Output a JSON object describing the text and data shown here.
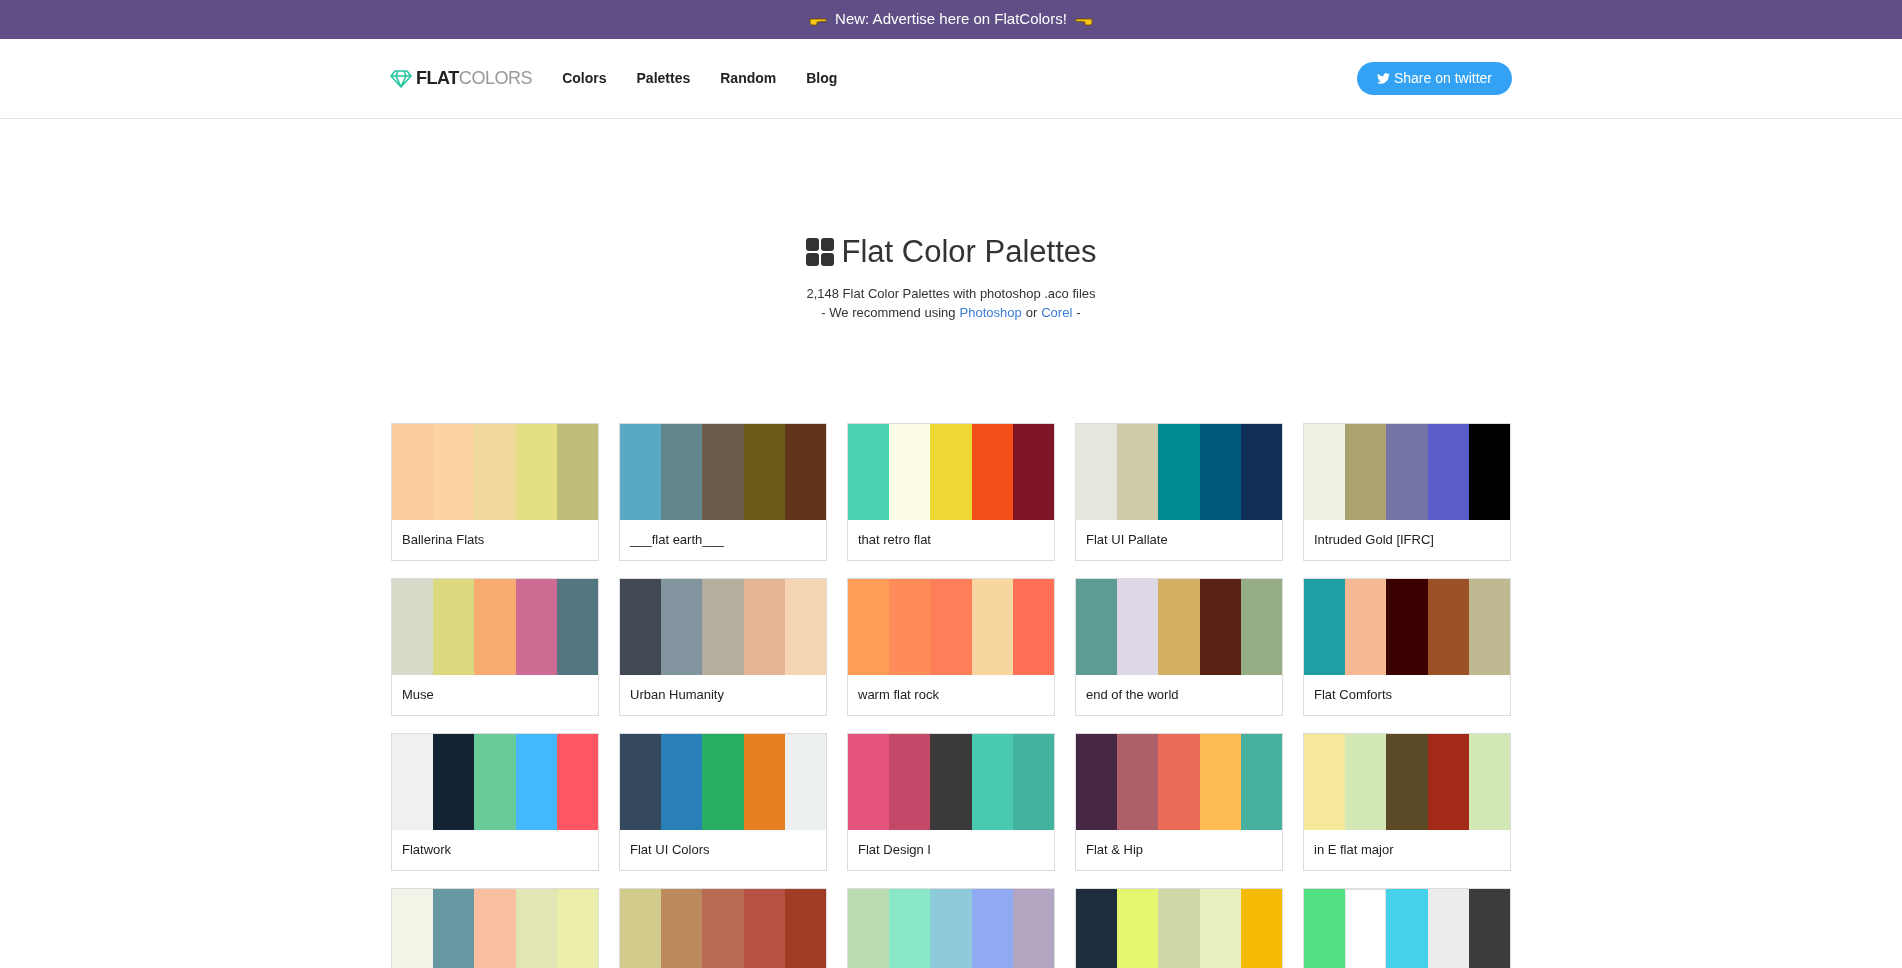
{
  "banner": {
    "text": "New: Advertise here on FlatColors!"
  },
  "nav": {
    "logo": {
      "bold": "FLAT",
      "light": "COLORS"
    },
    "links": [
      "Colors",
      "Palettes",
      "Random",
      "Blog"
    ],
    "share_button": "Share on twitter"
  },
  "hero": {
    "title": "Flat Color Palettes",
    "subtitle": "2,148 Flat Color Palettes with photoshop .aco files",
    "recommend": {
      "before": "- We recommend using",
      "link1": "Photoshop",
      "middle": "or",
      "link2": "Corel",
      "after": "-"
    }
  },
  "palettes": [
    {
      "name": "Ballerina Flats",
      "swatches": [
        {
          "color": "#fbcb9c"
        },
        {
          "color": "#fcd3a1"
        },
        {
          "color": "#f1d89d"
        },
        {
          "color": "#e4df83"
        },
        {
          "color": "#bfbc7a"
        }
      ]
    },
    {
      "name": "___flat earth___",
      "swatches": [
        {
          "color": "#5aa9c4"
        },
        {
          "color": "#61868d"
        },
        {
          "color": "#6c5c4b"
        },
        {
          "color": "#695a16"
        },
        {
          "color": "#613519"
        }
      ]
    },
    {
      "name": "that retro flat",
      "swatches": [
        {
          "color": "#4bd4b3"
        },
        {
          "color": "#fdfce7"
        },
        {
          "color": "#edd834"
        },
        {
          "color": "#f24e1a"
        },
        {
          "color": "#7e1426"
        }
      ]
    },
    {
      "name": "Flat UI Pallate",
      "swatches": [
        {
          "color": "#e5e6de"
        },
        {
          "color": "#cfcaa7"
        },
        {
          "color": "#028a92"
        },
        {
          "color": "#015a7b"
        },
        {
          "color": "#0f2f57"
        }
      ]
    },
    {
      "name": "Intruded Gold [IFRC]",
      "swatches": [
        {
          "color": "#eef2e4"
        },
        {
          "color": "#aaa36f"
        },
        {
          "color": "#7475a6"
        },
        {
          "color": "#5a5cc9"
        },
        {
          "color": "#000000"
        }
      ]
    },
    {
      "name": "Muse",
      "swatches": [
        {
          "color": "#d6dbc9"
        },
        {
          "color": "#dcd880"
        },
        {
          "color": "#f8ab71"
        },
        {
          "color": "#cd6b93"
        },
        {
          "color": "#537780"
        }
      ]
    },
    {
      "name": "Urban Humanity",
      "swatches": [
        {
          "color": "#424954"
        },
        {
          "color": "#82959f"
        },
        {
          "color": "#b5ae9f"
        },
        {
          "color": "#e3b594"
        },
        {
          "color": "#f6d5b3"
        }
      ]
    },
    {
      "name": "warm flat rock",
      "swatches": [
        {
          "color": "#ff9e57"
        },
        {
          "color": "#ff8c59"
        },
        {
          "color": "#ff7f59"
        },
        {
          "color": "#f7d69f"
        },
        {
          "color": "#ff7056"
        }
      ]
    },
    {
      "name": "end of the world",
      "swatches": [
        {
          "color": "#5c9c92"
        },
        {
          "color": "#ded8e6"
        },
        {
          "color": "#d4ae62"
        },
        {
          "color": "#5a2215"
        },
        {
          "color": "#96ad87"
        }
      ]
    },
    {
      "name": "Flat Comforts",
      "swatches": [
        {
          "color": "#1f9ea3"
        },
        {
          "color": "#f7b994"
        },
        {
          "color": "#3b0000"
        },
        {
          "color": "#9c5028"
        },
        {
          "color": "#bfb992"
        }
      ]
    },
    {
      "name": "Flatwork",
      "swatches": [
        {
          "color": "#eff0f2"
        },
        {
          "color": "#132334"
        },
        {
          "color": "#67cc97"
        },
        {
          "color": "#44b8fe"
        },
        {
          "color": "#fe5763"
        }
      ]
    },
    {
      "name": "Flat UI Colors",
      "swatches": [
        {
          "color": "#34495e"
        },
        {
          "color": "#2980b9"
        },
        {
          "color": "#27ae60"
        },
        {
          "color": "#e67e22"
        },
        {
          "color": "#ecf0f1"
        }
      ]
    },
    {
      "name": "Flat Design I",
      "swatches": [
        {
          "color": "#e4547c"
        },
        {
          "color": "#c44867"
        },
        {
          "color": "#3a3a3b"
        },
        {
          "color": "#48c9b0"
        },
        {
          "color": "#42b39c"
        }
      ]
    },
    {
      "name": "Flat & Hip",
      "swatches": [
        {
          "color": "#462645"
        },
        {
          "color": "#ae5f69"
        },
        {
          "color": "#eb6b57"
        },
        {
          "color": "#fdbd54"
        },
        {
          "color": "#46b29d"
        }
      ]
    },
    {
      "name": "in E flat major",
      "swatches": [
        {
          "color": "#f6e89b"
        },
        {
          "color": "#d3e8b5"
        },
        {
          "color": "#5c4a27"
        },
        {
          "color": "#a22a17"
        },
        {
          "color": "#d3e8b5"
        }
      ]
    },
    {
      "swatches": [
        {
          "color": "#f0f5e8"
        },
        {
          "color": "#6899a3"
        },
        {
          "color": "#f8bfa0"
        },
        {
          "color": "#e2e6b4"
        },
        {
          "color": "#ebedaa"
        }
      ]
    },
    {
      "swatches": [
        {
          "color": "#d1cc8c"
        },
        {
          "color": "#bd8a5e"
        },
        {
          "color": "#b96a53"
        },
        {
          "color": "#b85244"
        },
        {
          "color": "#9e3d24"
        }
      ]
    },
    {
      "swatches": [
        {
          "color": "#badcb0"
        },
        {
          "color": "#8ae8c6"
        },
        {
          "color": "#8ccadc"
        },
        {
          "color": "#8fa9f2"
        },
        {
          "color": "#b2a5c2"
        }
      ]
    },
    {
      "swatches": [
        {
          "color": "#1e2c3d"
        },
        {
          "color": "#e6f56e"
        },
        {
          "color": "#d1d6a9"
        },
        {
          "color": "#e8f0c2"
        },
        {
          "color": "#f6bb07"
        }
      ]
    },
    {
      "swatches": [
        {
          "color": "#52e082"
        },
        {
          "color": "#ffffff"
        },
        {
          "color": "#47d1e8"
        },
        {
          "color": "#ececec"
        },
        {
          "color": "#3b3b3b"
        }
      ]
    }
  ]
}
